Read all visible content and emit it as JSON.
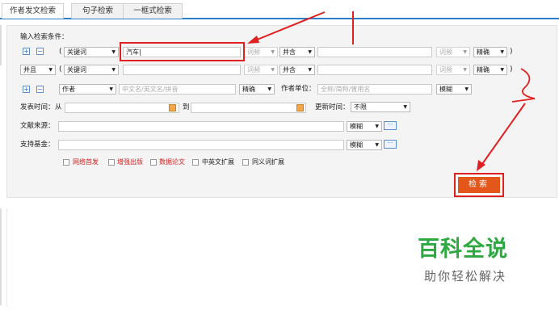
{
  "tabs": [
    "作者发文检索",
    "句子检索",
    "一框式检索"
  ],
  "form": {
    "heading": "输入检索条件：",
    "paren_open": "(",
    "paren_close": ")",
    "plus": "+",
    "minus": "−",
    "row1": {
      "field": "关键词",
      "value": "汽车|",
      "freq": "词频",
      "logic": "并含",
      "freq2": "词频",
      "match": "精确"
    },
    "row2": {
      "bool": "并且",
      "field": "关键词",
      "freq": "词频",
      "logic": "并含",
      "freq2": "词频",
      "match": "精确"
    },
    "author": {
      "field": "作者",
      "placeholder": "中文名/英文名/拼音",
      "match": "精确",
      "unit_label": "作者单位：",
      "unit_placeholder": "全称/简称/曾用名",
      "unit_match": "模糊"
    },
    "date": {
      "label": "发表时间：",
      "from": "从",
      "to": "到",
      "update_label": "更新时间：",
      "update_value": "不限"
    },
    "source": {
      "label": "文献来源：",
      "match": "模糊",
      "more": "···"
    },
    "fund": {
      "label": "支持基金：",
      "match": "模糊",
      "more": "···"
    },
    "options": [
      "网络首发",
      "增强出版",
      "数据论文",
      "中英文扩展",
      "同义词扩展"
    ],
    "search_button": "检索"
  },
  "watermark": {
    "title": "百科全说",
    "subtitle": "助你轻松解决"
  },
  "colors": {
    "accent": "#2a7fc8",
    "annotation": "#e02020",
    "search_button": "#e4571a",
    "watermark": "#2ea840"
  }
}
